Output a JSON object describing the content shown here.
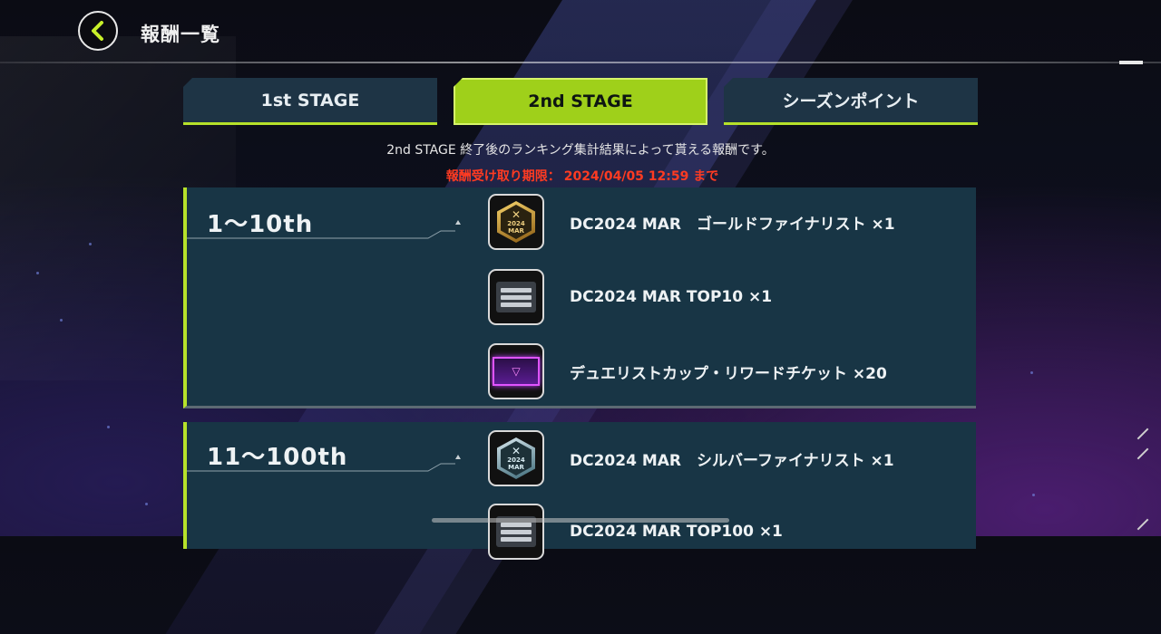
{
  "header": {
    "title": "報酬一覧",
    "back_icon": "chevron-left-icon"
  },
  "tabs": [
    {
      "label": "1st STAGE",
      "active": false
    },
    {
      "label": "2nd STAGE",
      "active": true
    },
    {
      "label": "シーズンポイント",
      "active": false
    }
  ],
  "description": "2nd STAGE 終了後のランキング集計結果によって貰える報酬です。",
  "deadline": {
    "label": "報酬受け取り期限：",
    "value": "2024/04/05 12:59 まで"
  },
  "ranks": [
    {
      "label": "1〜10th",
      "rewards": [
        {
          "icon": "gold-finalist-badge-icon",
          "label": "DC2024 MAR　ゴールドファイナリスト ×1"
        },
        {
          "icon": "top10-box-icon",
          "label": "DC2024 MAR TOP10 ×1"
        },
        {
          "icon": "reward-ticket-icon",
          "label": "デュエリストカップ・リワードチケット ×20"
        }
      ]
    },
    {
      "label": "11〜100th",
      "rewards": [
        {
          "icon": "silver-finalist-badge-icon",
          "label": "DC2024 MAR　シルバーファイナリスト ×1"
        },
        {
          "icon": "top100-box-icon",
          "label": "DC2024 MAR TOP100 ×1"
        }
      ]
    }
  ],
  "colors": {
    "accent": "#b6e12a",
    "panel": "#183545",
    "deadline": "#ff3b22"
  }
}
